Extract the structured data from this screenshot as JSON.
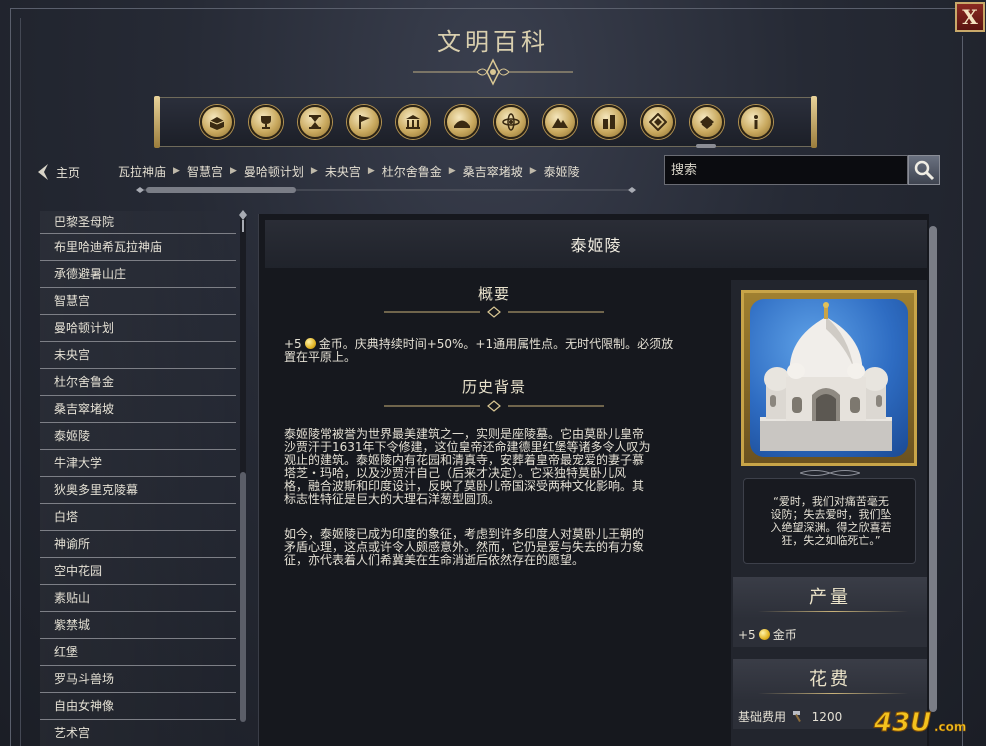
{
  "window": {
    "title": "文明百科",
    "close_label": "X"
  },
  "categories": [
    {
      "icon": "boxes-icon",
      "name": "category-1"
    },
    {
      "icon": "trophy-icon",
      "name": "category-2"
    },
    {
      "icon": "hourglass-icon",
      "name": "category-3"
    },
    {
      "icon": "flag-icon",
      "name": "category-4"
    },
    {
      "icon": "building-icon",
      "name": "category-5"
    },
    {
      "icon": "tent-icon",
      "name": "category-6"
    },
    {
      "icon": "atom-icon",
      "name": "category-7"
    },
    {
      "icon": "mountain-icon",
      "name": "category-8"
    },
    {
      "icon": "district-icon",
      "name": "category-9"
    },
    {
      "icon": "diamond-icon",
      "name": "category-10"
    },
    {
      "icon": "book-icon",
      "name": "category-11"
    },
    {
      "icon": "info-icon",
      "name": "category-12"
    }
  ],
  "nav": {
    "home_label": "主页",
    "breadcrumb": [
      "哈瓦拉神庙",
      "智慧宫",
      "曼哈顿计划",
      "未央宫",
      "杜尔舍鲁金",
      "桑吉窣堵坡",
      "泰姬陵"
    ]
  },
  "search": {
    "placeholder": "搜索"
  },
  "sidebar": {
    "items": [
      "巴黎圣母院",
      "布里哈迪希瓦拉神庙",
      "承德避暑山庄",
      "智慧宫",
      "曼哈顿计划",
      "未央宫",
      "杜尔舍鲁金",
      "桑吉窣堵坡",
      "泰姬陵",
      "牛津大学",
      "狄奥多里克陵幕",
      "白塔",
      "神谕所",
      "空中花园",
      "素贴山",
      "紫禁城",
      "红堡",
      "罗马斗兽场",
      "自由女神像",
      "艺术宫"
    ]
  },
  "article": {
    "title": "泰姬陵",
    "summary_heading": "概要",
    "summary_prefix": "+5",
    "summary_line1": "金币。庆典持续时间+50%。+1通用属性点。无时代限制。必须放",
    "summary_line2": "置在平原上。",
    "history_heading": "历史背景",
    "history_p1": [
      "泰姬陵常被誉为世界最美建筑之一，实则是座陵墓。它由莫卧儿皇帝",
      "沙贾汗于1631年下令修建，这位皇帝还命建德里红堡等诸多令人叹为",
      "观止的建筑。泰姬陵内有花园和清真寺，安葬着皇帝最宠爱的妻子慕",
      "塔芝・玛哈，以及沙贾汗自己（后来才决定）。它采独特莫卧儿风",
      "格，融合波斯和印度设计，反映了莫卧儿帝国深受两种文化影响。其",
      "标志性特征是巨大的大理石洋葱型圆顶。"
    ],
    "history_p2": [
      "如今，泰姬陵已成为印度的象征，考虑到许多印度人对莫卧儿王朝的",
      "矛盾心理，这点或许令人颇感意外。然而，它仍是爱与失去的有力象",
      "征，亦代表着人们希冀美在生命消逝后依然存在的愿望。"
    ],
    "quote": [
      "“爱时，我们对痛苦毫无",
      "设防；失去爱时，我们坠",
      "入绝望深渊。得之欣喜若",
      "狂，失之如临死亡。”"
    ],
    "production_heading": "产量",
    "production_value": "+5",
    "production_unit": "金币",
    "cost_heading": "花费",
    "cost_label": "基础费用",
    "cost_value": "1200"
  },
  "watermark": "43U.com",
  "colors": {
    "gold": "#c8a448",
    "background": "#262a35",
    "panel": "#16181e"
  }
}
